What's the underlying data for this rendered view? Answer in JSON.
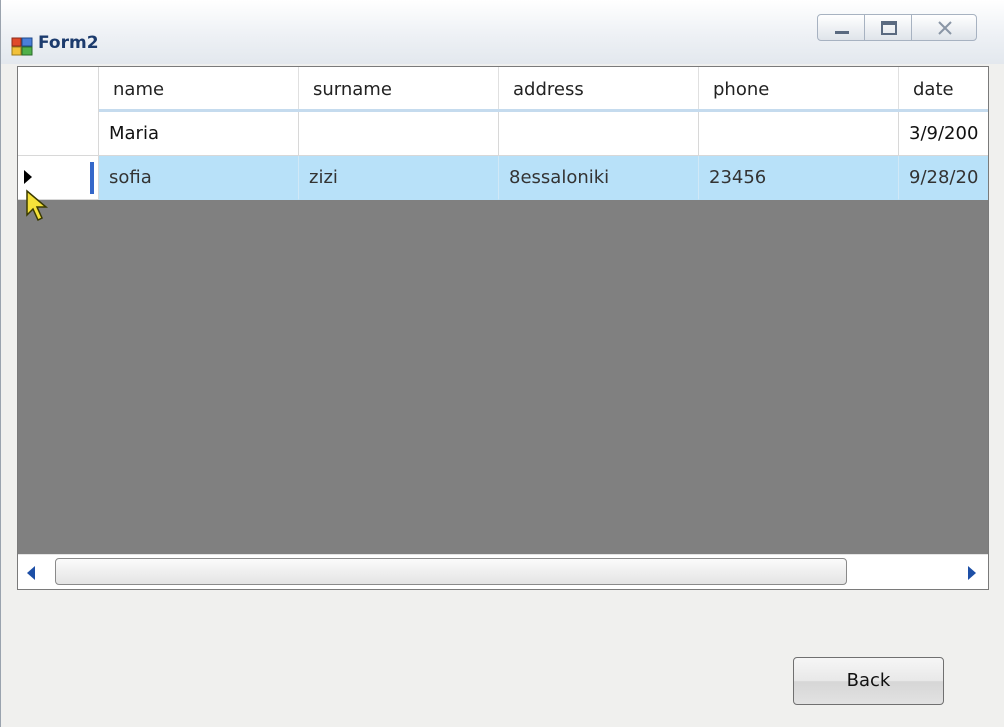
{
  "window": {
    "title": "Form2"
  },
  "grid": {
    "columns": [
      "name",
      "surname",
      "address",
      "phone",
      "date"
    ],
    "rows": [
      {
        "name": "Maria",
        "surname": "",
        "address": "",
        "phone": "",
        "date": "3/9/200"
      },
      {
        "name": "sofia",
        "surname": "zizi",
        "address": "8essaloniki",
        "phone": "23456",
        "date": "9/28/20"
      }
    ],
    "selected_row": 1
  },
  "buttons": {
    "back_label": "Back"
  },
  "colors": {
    "selection": "#b8e1f9",
    "grid_background": "#808080",
    "title_text": "#1c3b6d"
  }
}
